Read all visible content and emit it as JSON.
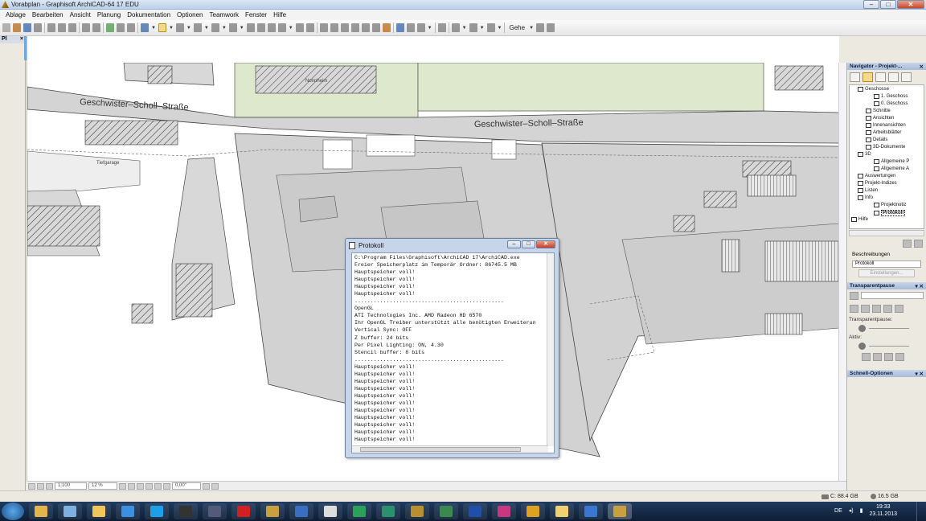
{
  "window": {
    "title": "Vorabplan - Graphisoft ArchiCAD-64 17 EDU",
    "min": "–",
    "max": "□",
    "close": "✕"
  },
  "menu": [
    "Ablage",
    "Bearbeiten",
    "Ansicht",
    "Planung",
    "Dokumentation",
    "Optionen",
    "Teamwork",
    "Fenster",
    "Hilfe"
  ],
  "toolbar": {
    "gehe_label": "Gehe"
  },
  "left_panel": {
    "label": "Pl",
    "close": "×"
  },
  "plan": {
    "street_left": "Geschwister–Scholl–Straße",
    "street_right": "Geschwister–Scholl–Straße",
    "label_tiefgarage": "Tiefgarage",
    "label_nonnheim": "Nonnheim"
  },
  "view_bar": {
    "scale": "1:100",
    "zoom": "12 %",
    "angle": "0,00°"
  },
  "status": {
    "disk": "C: 88.4 GB",
    "ram": "16.5 GB"
  },
  "navigator": {
    "title": "Navigator - Projekt-...",
    "tree": [
      {
        "label": "Geschosse"
      },
      {
        "label": "1. Geschoss"
      },
      {
        "label": "0. Geschoss"
      },
      {
        "label": "Schnitte"
      },
      {
        "label": "Ansichten"
      },
      {
        "label": "Innenansichten"
      },
      {
        "label": "Arbeitsblätter"
      },
      {
        "label": "Details"
      },
      {
        "label": "3D-Dokumente"
      },
      {
        "label": "3D"
      },
      {
        "label": "Allgemeine P"
      },
      {
        "label": "Allgemeine A"
      },
      {
        "label": "Auswertungen"
      },
      {
        "label": "Projekt-Indizes"
      },
      {
        "label": "Listen"
      },
      {
        "label": "Info"
      },
      {
        "label": "Projektnotiz"
      },
      {
        "label": "Protokoll"
      },
      {
        "label": "Hilfe"
      }
    ],
    "beschreibungen": "Beschreibungen",
    "field_value": "Protokoll",
    "einstellungen": "Einstellungen..."
  },
  "transparent_panel": {
    "title": "Transparentpause",
    "label_pause": "Transparentpause:",
    "label_aktiv": "Aktiv:"
  },
  "schnell_panel": {
    "title": "Schnell-Optionen"
  },
  "dialog": {
    "title": "Protokoll",
    "lines": [
      "C:\\Program Files\\Graphisoft\\ArchiCAD 17\\ArchiCAD.exe",
      "Freier Speicherplatz im Temporär Ordner: 86745.5 MB",
      "Hauptspeicher voll!",
      "Hauptspeicher voll!",
      "Hauptspeicher voll!",
      "Hauptspeicher voll!",
      "...............................................",
      "OpenGL",
      "ATI Technologies Inc. AMD Radeon HD 6570",
      "Ihr OpenGL Treiber unterstützt alle benötigten Erweiterun",
      "Vertical Sync: OFF",
      "Z buffer: 24 bits",
      "Per Pixel Lighting: ON, 4.30",
      "Stencil buffer: 8 bits",
      "...............................................",
      "Hauptspeicher voll!",
      "Hauptspeicher voll!",
      "Hauptspeicher voll!",
      "Hauptspeicher voll!",
      "Hauptspeicher voll!",
      "Hauptspeicher voll!",
      "Hauptspeicher voll!",
      "Hauptspeicher voll!",
      "Hauptspeicher voll!",
      "Hauptspeicher voll!",
      "Hauptspeicher voll!"
    ]
  },
  "taskbar": {
    "lang": "DE",
    "time": "19:33",
    "date": "23.11.2013",
    "apps": [
      {
        "name": "explorer",
        "color": "#e3b64c"
      },
      {
        "name": "notes",
        "color": "#7fb0e0"
      },
      {
        "name": "folder",
        "color": "#f0c85a"
      },
      {
        "name": "dropbox",
        "color": "#3d8fe0"
      },
      {
        "name": "skype",
        "color": "#1ea0e8"
      },
      {
        "name": "camera",
        "color": "#333333"
      },
      {
        "name": "webcam",
        "color": "#555a7a"
      },
      {
        "name": "acrobat",
        "color": "#d02020"
      },
      {
        "name": "archicad-a",
        "color": "#c8a040"
      },
      {
        "name": "vectorworks",
        "color": "#3a6ec0"
      },
      {
        "name": "cinema",
        "color": "#dddddd"
      },
      {
        "name": "gem",
        "color": "#2aa05a"
      },
      {
        "name": "sketchup",
        "color": "#2a9070"
      },
      {
        "name": "archicad-b",
        "color": "#b89030"
      },
      {
        "name": "ms-project",
        "color": "#3a8a50"
      },
      {
        "name": "photoshop",
        "color": "#1f4fa8"
      },
      {
        "name": "indesign",
        "color": "#c83880"
      },
      {
        "name": "chrome",
        "color": "#e0a020"
      },
      {
        "name": "folder-2",
        "color": "#f0d070"
      },
      {
        "name": "ie",
        "color": "#3a78d0"
      },
      {
        "name": "archicad-active",
        "color": "#c8a040"
      }
    ]
  }
}
